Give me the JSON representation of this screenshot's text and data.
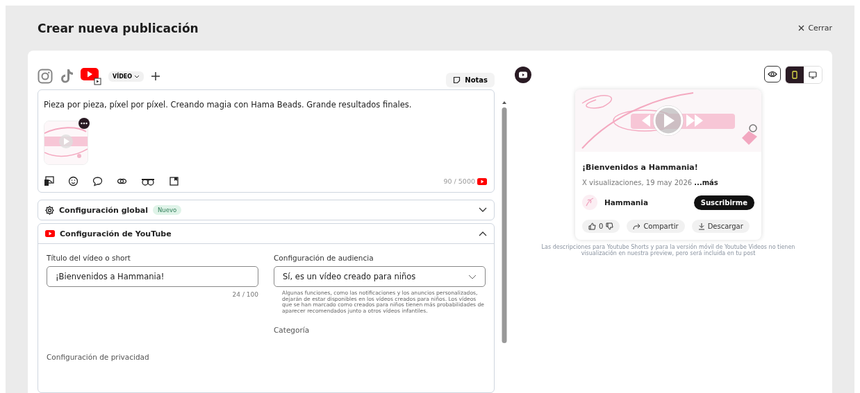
{
  "header": {
    "title": "Crear nueva publicación",
    "close_label": "Cerrar"
  },
  "platforms": [
    {
      "kind": "instagram",
      "selected": false
    },
    {
      "kind": "tiktok",
      "selected": false
    },
    {
      "kind": "youtube",
      "selected": true
    }
  ],
  "format_dropdown": "VÍDEO",
  "notes_button": "Notas",
  "editor": {
    "text": "Pieza por pieza, píxel por píxel. Creando magia con Hama Beads. Grande resultados finales.",
    "counter": "90 / 5000"
  },
  "global_settings": {
    "title": "Configuración global",
    "badge": "Nuevo",
    "expanded": false
  },
  "youtube_settings": {
    "title": "Configuración de YouTube",
    "expanded": true,
    "video_title": {
      "label": "Título del vídeo o short",
      "value": "¡Bienvenidos a Hammania!",
      "counter": "24 / 100"
    },
    "audience": {
      "label": "Configuración de audiencia",
      "value": "Sí, es un vídeo creado para niños",
      "help": "Algunas funciones, como las notificaciones y los anuncios personalizados, dejarán de estar disponibles en los vídeos creados para niños. Los vídeos que se han marcado como creados para niños tienen más probabilidades de aparecer recomendados junto a otros vídeos infantiles."
    },
    "privacy_label": "Configuración de privacidad",
    "category_label": "Categoría"
  },
  "preview": {
    "visible": true,
    "view_modes": [
      {
        "kind": "mobile",
        "selected": true
      },
      {
        "kind": "desktop",
        "selected": false
      }
    ],
    "title": "¡Bienvenidos a Hammania!",
    "meta": "X visualizaciones, 19 may 2026",
    "more": "...más",
    "channel": "Hammania",
    "subscribe": "Suscribirme",
    "likes": "0",
    "share": "Compartir",
    "download": "Descargar",
    "note": "Las descripciones para Youtube Shorts y para la versión móvil de Youtube Videos no tienen visualización en nuestra preview, pero será incluida en tu post"
  }
}
